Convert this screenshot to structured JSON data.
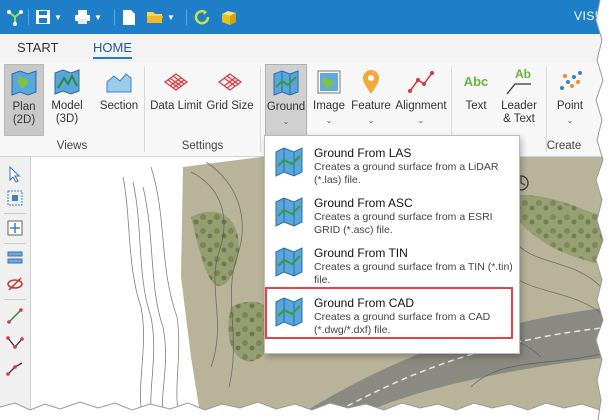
{
  "app": {
    "title_fragment": "VISU"
  },
  "tabs": [
    {
      "label": "START"
    },
    {
      "label": "HOME"
    }
  ],
  "ribbon": {
    "views": {
      "label": "Views",
      "plan_line1": "Plan",
      "plan_line2": "(2D)",
      "model_line1": "Model",
      "model_line2": "(3D)",
      "section": "Section"
    },
    "settings": {
      "label": "Settings",
      "data_limit": "Data Limit",
      "grid_size": "Grid Size"
    },
    "create": {
      "label": "Create",
      "ground": "Ground",
      "image": "Image",
      "feature": "Feature",
      "alignment": "Alignment",
      "text": "Text",
      "leader_line1": "Leader",
      "leader_line2": "& Text",
      "point": "Point"
    }
  },
  "ground_menu": {
    "items": [
      {
        "title": "Ground From LAS",
        "desc": "Creates a ground surface from a LiDAR (*.las) file."
      },
      {
        "title": "Ground From ASC",
        "desc": "Creates a ground surface from a ESRI GRID (*.asc) file."
      },
      {
        "title": "Ground From TIN",
        "desc": "Creates a ground surface from a TIN (*.tin) file."
      },
      {
        "title": "Ground From CAD",
        "desc": "Creates a ground surface from a CAD (*.dwg/*.dxf) file."
      }
    ]
  },
  "icons": {
    "text_glyph": "Abc",
    "leader_glyph": "Ab"
  },
  "colors": {
    "titlebar": "#1e7fc8",
    "highlight": "#e0454a",
    "accent": "#1e5c9a"
  }
}
